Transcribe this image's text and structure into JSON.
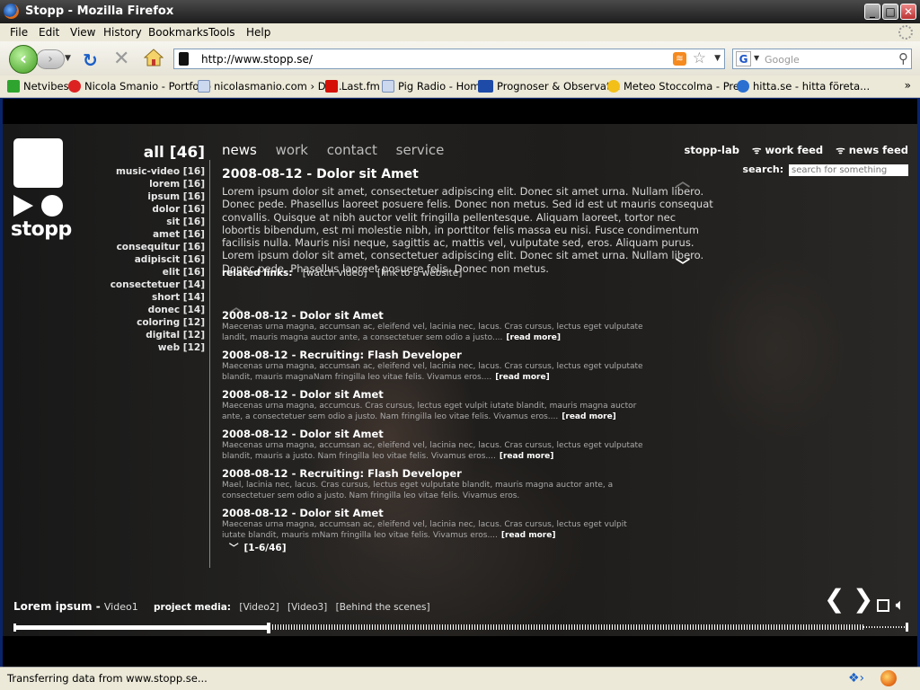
{
  "window": {
    "title": "Stopp - Mozilla Firefox"
  },
  "menu": [
    "File",
    "Edit",
    "View",
    "History",
    "Bookmarks",
    "Tools",
    "Help"
  ],
  "address": {
    "url": "http://www.stopp.se/"
  },
  "search_engine": {
    "placeholder": "Google"
  },
  "bookmarks": [
    {
      "label": "Netvibes",
      "color": "#2fa52f"
    },
    {
      "label": "Nicola Smanio - Portfolio",
      "color": "#d22"
    },
    {
      "label": "nicolasmanio.com › Da...",
      "color": "#ccd8ee"
    },
    {
      "label": "Last.fm",
      "color": "#d51007"
    },
    {
      "label": "Pig Radio - Home",
      "color": "#ccd8ee"
    },
    {
      "label": "Prognoser & Observat...",
      "color": "#1e4aa8"
    },
    {
      "label": "Meteo Stoccolma - Pre...",
      "color": "#f3c019"
    },
    {
      "label": "hitta.se - hitta företa...",
      "color": "#2b6fd1"
    }
  ],
  "site": {
    "logo_word": "stopp",
    "tags_all": "all [46]",
    "tags": [
      "music-video [16]",
      "lorem [16]",
      "ipsum [16]",
      "dolor [16]",
      "sit [16]",
      "amet [16]",
      "consequitur [16]",
      "adipiscit [16]",
      "elit [16]",
      "consectetuer [14]",
      "short [14]",
      "donec [14]",
      "coloring [12]",
      "digital [12]",
      "web [12]"
    ],
    "nav": [
      "news",
      "work",
      "contact",
      "service"
    ],
    "right_links": [
      "stopp-lab",
      "work feed",
      "news feed"
    ],
    "search_label": "search:",
    "search_placeholder": "search for something",
    "article": {
      "title": "2008-08-12 - Dolor sit Amet",
      "body": "Lorem ipsum dolor sit amet, consectetuer adipiscing elit. Donec sit amet urna. Nullam libero. Donec pede. Phasellus laoreet posuere felis. Donec non metus. Sed id est ut mauris consequat convallis. Quisque at nibh auctor velit fringilla pellentesque. Aliquam laoreet, tortor nec lobortis bibendum, est mi molestie nibh, in porttitor felis massa eu nisi. Fusce condimentum facilisis nulla. Mauris nisi neque, sagittis ac, mattis vel, vulputate sed, eros. Aliquam purus. Lorem ipsum dolor sit amet, consectetuer adipiscing elit. Donec sit amet urna. Nullam libero. Donec pede. Phasellus laoreet posuere felis. Donec non metus.",
      "related_label": "related links:",
      "related": [
        "[watch video]",
        "[link to a website]"
      ]
    },
    "news_items": [
      {
        "title": "2008-08-12 - Dolor sit Amet",
        "body": "Maecenas urna magna, accumsan ac, eleifend vel, lacinia nec, lacus. Cras cursus, lectus eget vulputate landit, mauris magna auctor ante, a consectetuer sem odio a justo....",
        "more": "[read more]"
      },
      {
        "title": "2008-08-12 - Recruiting: Flash Developer",
        "body": "Maecenas urna magna, accumsan ac, eleifend vel, lacinia nec, lacus. Cras cursus, lectus eget vulputate blandit, mauris magnaNam fringilla leo vitae felis. Vivamus eros....",
        "more": "[read more]"
      },
      {
        "title": "2008-08-12 - Dolor sit Amet",
        "body": "Maecenas urna magna, accumcus. Cras cursus, lectus eget vulpit iutate blandit, mauris magna auctor ante, a consectetuer sem odio a justo. Nam fringilla leo vitae felis. Vivamus eros....",
        "more": "[read more]"
      },
      {
        "title": "2008-08-12 - Dolor sit Amet",
        "body": "Maecenas urna magna, accumsan ac, eleifend vel, lacinia nec, lacus. Cras cursus, lectus eget vulputate blandit, mauris a justo. Nam fringilla leo vitae felis. Vivamus eros....",
        "more": "[read more]"
      },
      {
        "title": "2008-08-12 - Recruiting: Flash Developer",
        "body": "Mael, lacinia nec, lacus. Cras cursus, lectus eget vulputate blandit, mauris magna auctor ante, a consectetuer sem odio a justo. Nam fringilla leo vitae felis. Vivamus eros.",
        "more": ""
      },
      {
        "title": "2008-08-12 - Dolor sit Amet",
        "body": "Maecenas urna magna, accumsan ac, eleifend vel, lacinia nec, lacus. Cras cursus, lectus eget vulpit iutate blandit, mauris mNam fringilla leo vitae felis. Vivamus eros....",
        "more": "[read more]"
      }
    ],
    "pager": "[1-6/46]",
    "video": {
      "title": "Lorem ipsum",
      "sep": " - ",
      "name": "Video1",
      "media_label": "project media:",
      "media": [
        "[Video2]",
        "[Video3]",
        "[Behind the scenes]"
      ],
      "progress_played": 0.285,
      "progress_buffered": 0.95
    }
  },
  "status": {
    "text": "Transferring data from www.stopp.se..."
  }
}
